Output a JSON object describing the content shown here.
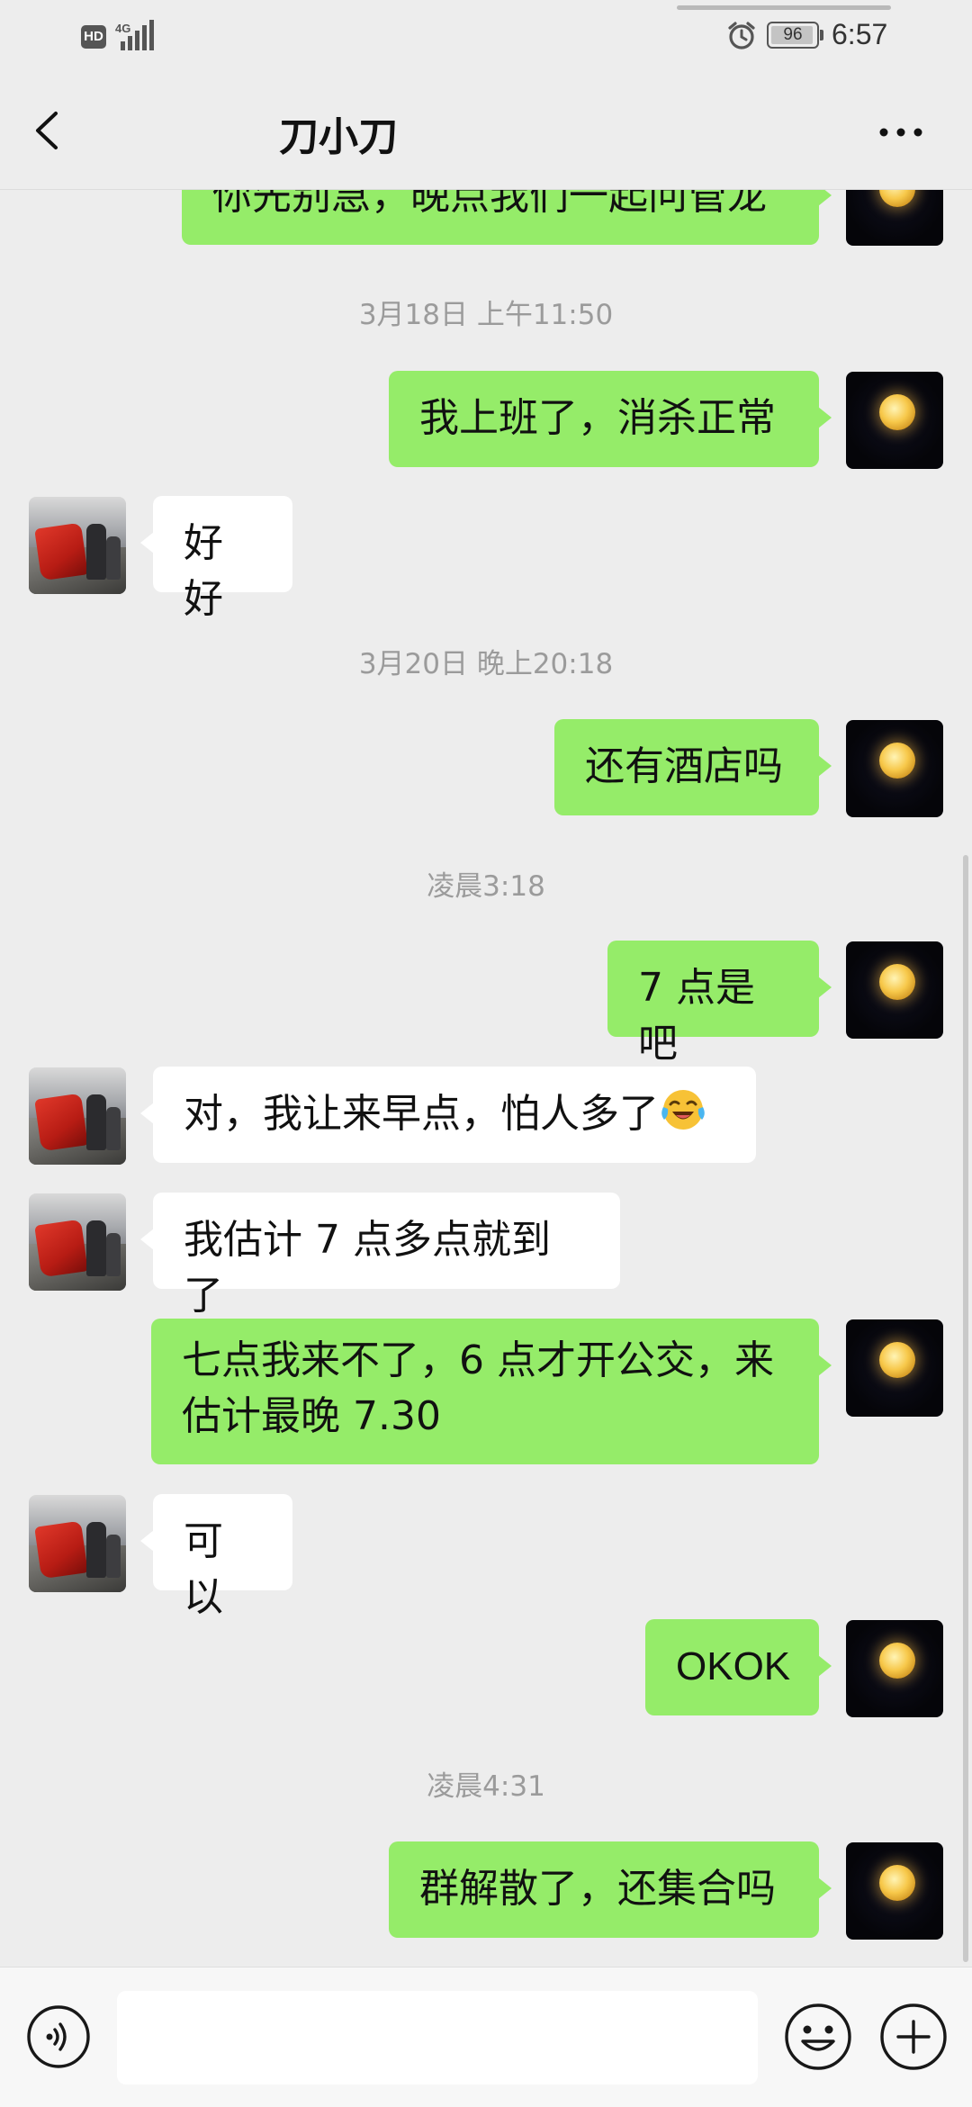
{
  "status_bar": {
    "hd_label": "HD",
    "network_label": "4G",
    "battery_level": "96",
    "battery_fraction": 0.96,
    "time": "6:57"
  },
  "header": {
    "title": "刀小刀",
    "back_icon": "chevron-left-icon",
    "more_icon": "ellipsis-icon"
  },
  "messages": [
    {
      "type": "message",
      "side": "self",
      "text": "你先别急，晚点我们一起问管龙"
    },
    {
      "type": "timestamp",
      "text": "3月18日 上午11:50"
    },
    {
      "type": "message",
      "side": "self",
      "text": "我上班了，消杀正常"
    },
    {
      "type": "message",
      "side": "other",
      "text": "好好"
    },
    {
      "type": "timestamp",
      "text": "3月20日 晚上20:18"
    },
    {
      "type": "message",
      "side": "self",
      "text": "还有酒店吗"
    },
    {
      "type": "timestamp",
      "text": "凌晨3:18"
    },
    {
      "type": "message",
      "side": "self",
      "text": "7 点是吧"
    },
    {
      "type": "message",
      "side": "other",
      "text": "对，我让来早点，怕人多了",
      "emoji": "laughing-crying-emoji"
    },
    {
      "type": "message",
      "side": "other",
      "text": "我估计 7 点多点就到了"
    },
    {
      "type": "message",
      "side": "self",
      "text": "七点我来不了，6 点才开公交，来\n估计最晚 7.30"
    },
    {
      "type": "message",
      "side": "other",
      "text": "可以"
    },
    {
      "type": "message",
      "side": "self",
      "text": "OKOK"
    },
    {
      "type": "timestamp",
      "text": "凌晨4:31"
    },
    {
      "type": "message",
      "side": "self",
      "text": "群解散了，还集合吗"
    }
  ],
  "input_bar": {
    "input_value": "",
    "voice_icon": "voice-icon",
    "emoji_icon": "smiley-icon",
    "plus_icon": "plus-icon"
  },
  "colors": {
    "background": "#ededed",
    "self_bubble": "#95ec69",
    "other_bubble": "#ffffff",
    "timestamp_text": "#9b9b9b"
  }
}
